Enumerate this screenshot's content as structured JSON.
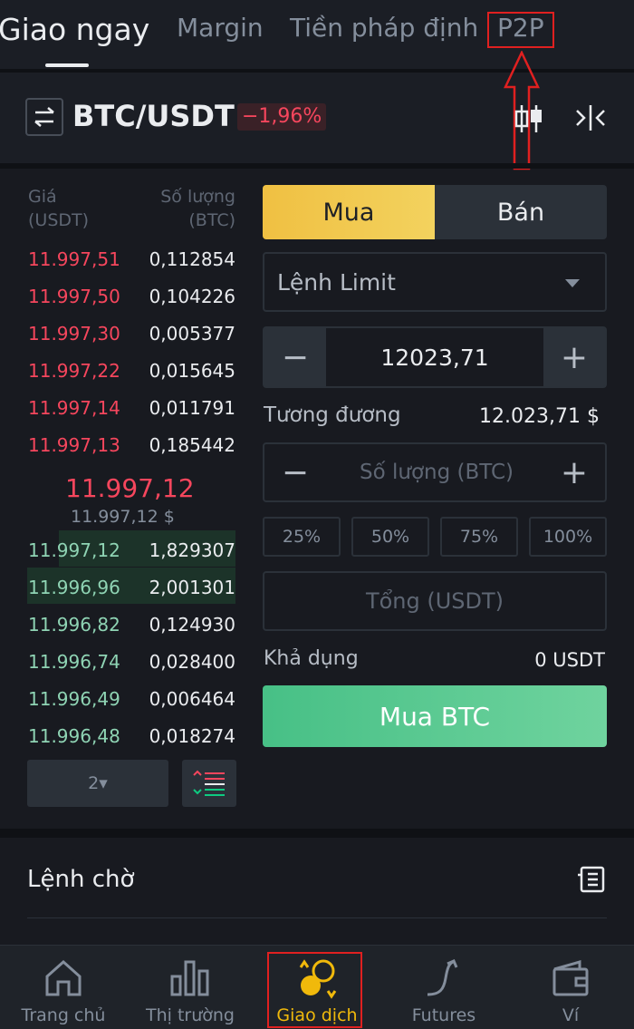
{
  "top_tabs": [
    {
      "label": "Giao ngay",
      "active": true
    },
    {
      "label": "Margin",
      "active": false
    },
    {
      "label": "Tiền pháp định",
      "active": false
    },
    {
      "label": "P2P",
      "active": false
    }
  ],
  "pair": {
    "name": "BTC/USDT",
    "change": "−1,96%"
  },
  "orderbook": {
    "price_header_1": "Giá",
    "price_header_2": "(USDT)",
    "qty_header_1": "Số lượng",
    "qty_header_2": "(BTC)",
    "asks": [
      {
        "price": "11.997,51",
        "qty": "0,112854"
      },
      {
        "price": "11.997,50",
        "qty": "0,104226"
      },
      {
        "price": "11.997,30",
        "qty": "0,005377"
      },
      {
        "price": "11.997,22",
        "qty": "0,015645"
      },
      {
        "price": "11.997,14",
        "qty": "0,011791"
      },
      {
        "price": "11.997,13",
        "qty": "0,185442"
      }
    ],
    "last_price": "11.997,12",
    "last_price_usd": "11.997,12 $",
    "bids": [
      {
        "price": "11.997,12",
        "qty": "1,829307",
        "depth": 0.78
      },
      {
        "price": "11.996,96",
        "qty": "2,001301",
        "depth": 0.92
      },
      {
        "price": "11.996,82",
        "qty": "0,124930",
        "depth": 0.0
      },
      {
        "price": "11.996,74",
        "qty": "0,028400",
        "depth": 0.0
      },
      {
        "price": "11.996,49",
        "qty": "0,006464",
        "depth": 0.0
      },
      {
        "price": "11.996,48",
        "qty": "0,018274",
        "depth": 0.0
      }
    ],
    "precision": "2▾"
  },
  "trade": {
    "buy_label": "Mua",
    "sell_label": "Bán",
    "order_type": "Lệnh Limit",
    "minus": "−",
    "plus": "+",
    "price_value": "12023,71",
    "equiv_label": "Tương đương",
    "equiv_value": "12.023,71 $",
    "qty_placeholder": "Số lượng (BTC)",
    "percentages": [
      "25%",
      "50%",
      "75%",
      "100%"
    ],
    "total_placeholder": "Tổng (USDT)",
    "available_label": "Khả dụng",
    "available_value": "0 USDT",
    "buy_button": "Mua BTC"
  },
  "orders": {
    "title": "Lệnh chờ"
  },
  "nav": [
    {
      "label": "Trang chủ",
      "icon": "home-icon"
    },
    {
      "label": "Thị trường",
      "icon": "markets-icon"
    },
    {
      "label": "Giao dịch",
      "icon": "trade-icon",
      "active": true
    },
    {
      "label": "Futures",
      "icon": "futures-icon"
    },
    {
      "label": "Ví",
      "icon": "wallet-icon"
    }
  ],
  "colors": {
    "accent": "#f0b90b",
    "up": "#0ecb81",
    "down": "#f6465d",
    "highlight": "#e02020"
  }
}
